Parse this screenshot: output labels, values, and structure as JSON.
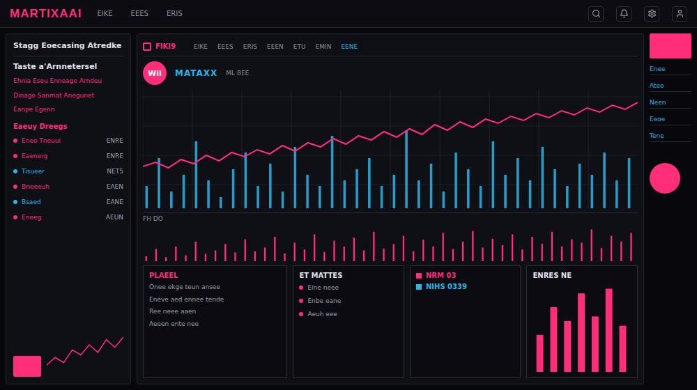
{
  "header": {
    "logo": "MARTIXAAI",
    "nav": [
      "EIKE",
      "EEES",
      "ERIS"
    ]
  },
  "sidebar": {
    "title": "Stagg Eoecasing Atredke",
    "heading": "Taste a'Arnnetersel",
    "notes": [
      "Ehnia Eseu Enneage Arndeu",
      "Dinago Sanmat Anegunet",
      "Eanpe Egenn"
    ],
    "list_title": "Eaeuy Dreegs",
    "items": [
      {
        "label": "Eneo Tneuui",
        "value": "ENRE",
        "color": "#ff2d7a"
      },
      {
        "label": "Eaenerg",
        "value": "ENRE",
        "color": "#ff2d7a"
      },
      {
        "label": "Tisueer",
        "value": "NET5",
        "color": "#29b6e8"
      },
      {
        "label": "Bneeeuh",
        "value": "EAEN",
        "color": "#ff2d7a"
      },
      {
        "label": "Bsaed",
        "value": "EANE",
        "color": "#29b6e8"
      },
      {
        "label": "Eneeg",
        "value": "AEUN",
        "color": "#ff2d7a"
      }
    ],
    "spark": [
      20,
      35,
      25,
      50,
      40,
      60,
      45,
      70,
      55,
      75
    ]
  },
  "chart_panel": {
    "tab": "FIKI9",
    "toolbar": [
      "EIKE",
      "EEES",
      "ERIS",
      "EEEN",
      "ETU",
      "EMIN",
      "EENE"
    ],
    "badge": "Wil",
    "label": "MATAXX",
    "axis_label": "ML BEE",
    "price": [
      30,
      33,
      29,
      35,
      32,
      38,
      34,
      40,
      37,
      42,
      39,
      45,
      41,
      47,
      44,
      50,
      46,
      52,
      49,
      55,
      51,
      57,
      53,
      60,
      56,
      62,
      58,
      64,
      61,
      66,
      63,
      68,
      65,
      70,
      67,
      72,
      69,
      74,
      71,
      76
    ],
    "volume": [
      20,
      45,
      15,
      30,
      60,
      25,
      10,
      35,
      50,
      20,
      40,
      15,
      55,
      30,
      20,
      65,
      25,
      35,
      45,
      20,
      30,
      70,
      25,
      40,
      15,
      50,
      35,
      20,
      60,
      30,
      45,
      25,
      55,
      35,
      20,
      40,
      30,
      50,
      25,
      45
    ],
    "wave_label": "FH DO",
    "wave": [
      10,
      25,
      8,
      30,
      12,
      40,
      15,
      22,
      35,
      18,
      45,
      20,
      28,
      50,
      16,
      38,
      24,
      55,
      19,
      42,
      30,
      48,
      22,
      60,
      26,
      35,
      52,
      20,
      44,
      30,
      58,
      25,
      40,
      62,
      28,
      46,
      33,
      55,
      24,
      50,
      36,
      60,
      30,
      45,
      38,
      65,
      27,
      52,
      40,
      58
    ]
  },
  "bottom": {
    "text_panel": {
      "title": "PLAEEL",
      "lines": [
        "Onee ekge teun ansee",
        "Eneve aed ennee tende",
        "Ree neee aaen",
        "Aeeen ente nee"
      ]
    },
    "list_card": {
      "title": "ET MATTES",
      "items": [
        "Eine neee",
        "Enbe eane",
        "Aeuh eee"
      ]
    },
    "stat_card": {
      "items": [
        {
          "label": "NRM 03",
          "color": "#ff2d7a"
        },
        {
          "label": "NIHS 0339",
          "color": "#29b6e8"
        }
      ]
    },
    "bars_card": {
      "title": "ENRES NE",
      "values": [
        40,
        70,
        55,
        85,
        60,
        90,
        50
      ]
    }
  },
  "right_rail": {
    "lines": [
      "Enee",
      "Ateo",
      "Neen",
      "Eeoe",
      "Tene"
    ]
  }
}
